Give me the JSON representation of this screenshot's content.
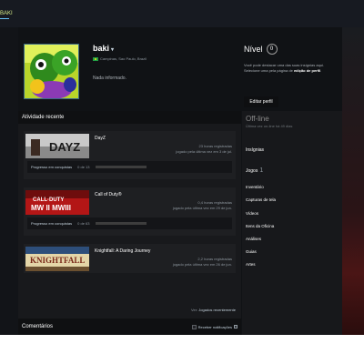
{
  "nav": {
    "active": "BAKI"
  },
  "profile": {
    "name": "baki",
    "caret": "▾",
    "location": "Campinas, Sao Paulo, Brazil",
    "summary": "Nada informado.",
    "level_label": "Nível",
    "level": "0",
    "level_desc_pre": "Você pode destacar uma das suas insígnias aqui. Selecione uma pela página de ",
    "level_desc_link": "edição de perfil",
    "level_desc_post": ".",
    "edit_button": "Editar perfil"
  },
  "activity": {
    "title": "Atividade recente",
    "games": [
      {
        "name": "DayZ",
        "hours": "23 horas registradas",
        "last": "jogado pela última vez em 3 de jul.",
        "ach_label": "Progresso em conquistas",
        "ach_count": "0 de 13",
        "thumb": "DAYZ"
      },
      {
        "name": "Call of Duty®",
        "hours": "0,4 horas registradas",
        "last": "jogado pela última vez em 29 de jun.",
        "ach_label": "Progresso em conquistas",
        "ach_count": "0 de 63",
        "thumb": "CALL·DUTY MW"
      },
      {
        "name": "Knightfall: A Daring Journey",
        "hours": "2,2 horas registradas",
        "last": "jogado pela última vez em 26 de jun.",
        "thumb": "KNIGHTFALL"
      }
    ],
    "recent_pre": "Ver:",
    "recent_link": "Jogados recentemente"
  },
  "comments": {
    "title": "Comentários",
    "notify": "Receber notificações",
    "help": "?"
  },
  "sidebar": {
    "status": "Off-line",
    "last_online": "Última vez on-line há 49 dias",
    "badges": "Insígnias",
    "games": "Jogos",
    "games_count": "1",
    "links": [
      "Inventário",
      "Capturas de tela",
      "Vídeos",
      "Itens da Oficina",
      "Análises",
      "Guias",
      "Artes"
    ]
  },
  "colors": {
    "accent": "#66c0f4",
    "background": "#101215",
    "panel": "#18191c"
  }
}
